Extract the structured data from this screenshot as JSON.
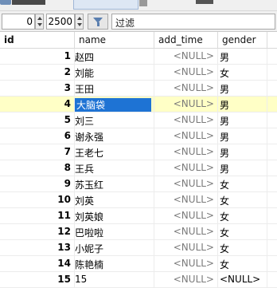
{
  "filterbar": {
    "offset_value": "0",
    "limit_value": "2500",
    "filter_placeholder": "过滤"
  },
  "table": {
    "columns": [
      "id",
      "name",
      "add_time",
      "gender"
    ],
    "rows": [
      {
        "id": "1",
        "name": "赵四",
        "add_time": "<NULL>",
        "gender": "男"
      },
      {
        "id": "2",
        "name": "刘能",
        "add_time": "<NULL>",
        "gender": "女"
      },
      {
        "id": "3",
        "name": "王田",
        "add_time": "<NULL>",
        "gender": "男"
      },
      {
        "id": "4",
        "name": "大脑袋",
        "add_time": "<NULL>",
        "gender": "男"
      },
      {
        "id": "5",
        "name": "刘三",
        "add_time": "<NULL>",
        "gender": "男"
      },
      {
        "id": "6",
        "name": "谢永强",
        "add_time": "<NULL>",
        "gender": "男"
      },
      {
        "id": "7",
        "name": "王老七",
        "add_time": "<NULL>",
        "gender": "男"
      },
      {
        "id": "8",
        "name": "王兵",
        "add_time": "<NULL>",
        "gender": "男"
      },
      {
        "id": "9",
        "name": "苏玉红",
        "add_time": "<NULL>",
        "gender": "女"
      },
      {
        "id": "10",
        "name": "刘英",
        "add_time": "<NULL>",
        "gender": "女"
      },
      {
        "id": "11",
        "name": "刘英娘",
        "add_time": "<NULL>",
        "gender": "女"
      },
      {
        "id": "12",
        "name": "巴啦啦",
        "add_time": "<NULL>",
        "gender": "女"
      },
      {
        "id": "13",
        "name": "小妮子",
        "add_time": "<NULL>",
        "gender": "女"
      },
      {
        "id": "14",
        "name": "陈艳楠",
        "add_time": "<NULL>",
        "gender": "女"
      },
      {
        "id": "15",
        "name": "15",
        "add_time": "<NULL>",
        "gender": "<NULL>"
      }
    ],
    "selected_row_index": 3
  }
}
